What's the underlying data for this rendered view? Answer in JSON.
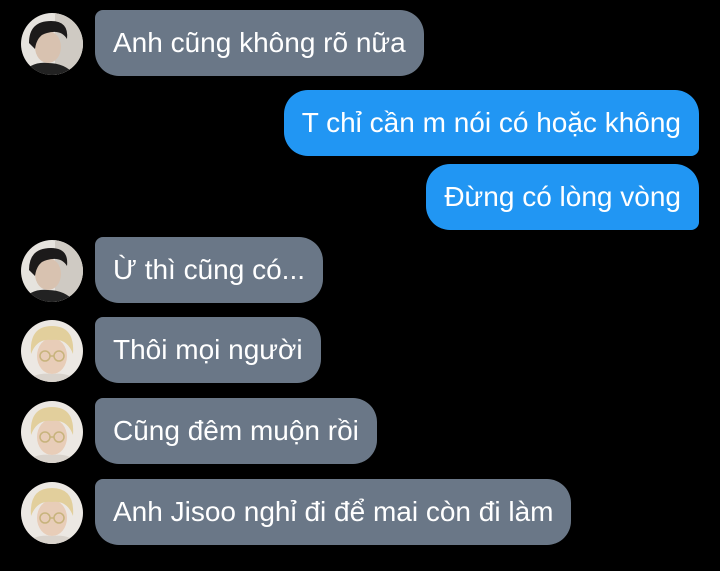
{
  "colors": {
    "background": "#000000",
    "incoming_bubble": "#6a7787",
    "outgoing_bubble": "#2196f3",
    "text": "#ffffff"
  },
  "messages": [
    {
      "direction": "incoming",
      "sender_avatar": "dark-haired-man-avatar",
      "text": "Anh cũng không rõ nữa"
    },
    {
      "direction": "outgoing",
      "text": "T chỉ cần m nói có hoặc không"
    },
    {
      "direction": "outgoing",
      "text": "Đừng có lòng vòng"
    },
    {
      "direction": "incoming",
      "sender_avatar": "dark-haired-man-avatar",
      "text": "Ừ thì cũng có..."
    },
    {
      "direction": "incoming",
      "sender_avatar": "blond-man-glasses-avatar",
      "text": "Thôi mọi người"
    },
    {
      "direction": "incoming",
      "sender_avatar": "blond-man-glasses-avatar",
      "text": "Cũng đêm muộn rồi"
    },
    {
      "direction": "incoming",
      "sender_avatar": "blond-man-glasses-avatar",
      "text": "Anh Jisoo nghỉ đi để mai còn đi làm"
    }
  ]
}
